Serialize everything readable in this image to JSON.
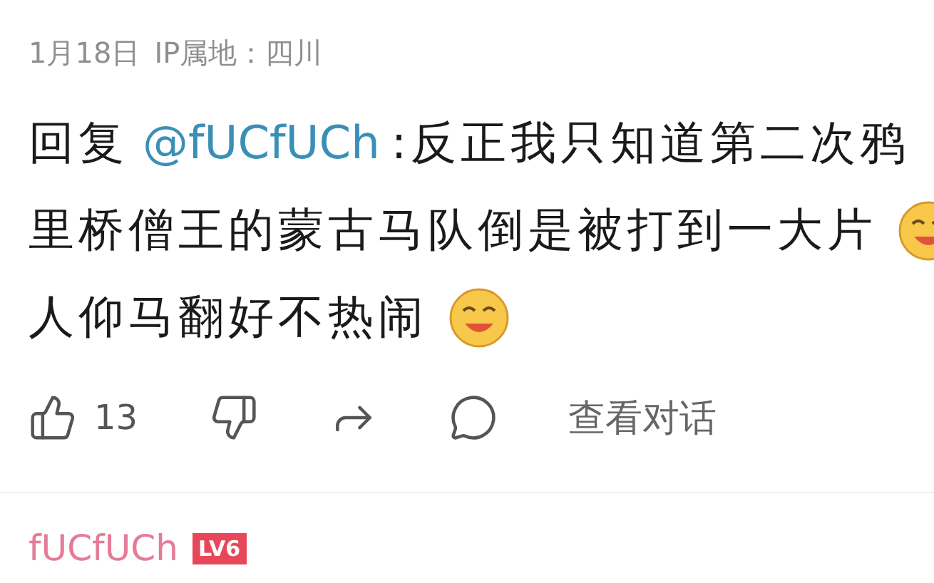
{
  "reply_meta": {
    "date": "1月18日",
    "ip_location": "IP属地：四川"
  },
  "comment": {
    "prefix": "回复",
    "mention": "@fUCfUCh",
    "lines": [
      {
        "text": ":反正我只知道第二次鸦",
        "emoji": false
      },
      {
        "text": "里桥僧王的蒙古马队倒是被打到一大片",
        "emoji": true
      },
      {
        "text": "人仰马翻好不热闹",
        "emoji": true
      }
    ]
  },
  "actions": {
    "like_count": "13",
    "view_conversation": "查看对话"
  },
  "next_comment": {
    "username": "fUCfUCh",
    "level": "LV6"
  }
}
